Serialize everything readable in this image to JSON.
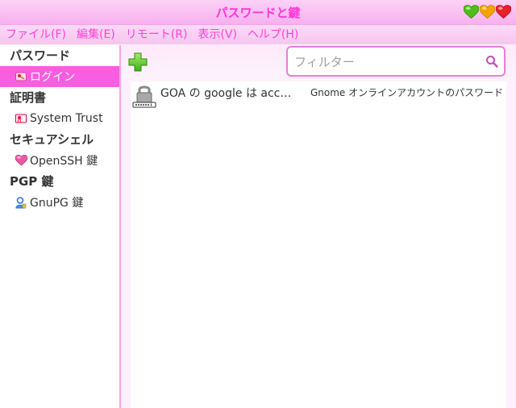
{
  "window": {
    "title": "パスワードと鍵"
  },
  "menubar": {
    "items": [
      "ファイル(F)",
      "編集(E)",
      "リモート(R)",
      "表示(V)",
      "ヘルプ(H)"
    ]
  },
  "sidebar": {
    "categories": [
      {
        "label": "パスワード",
        "items": [
          {
            "label": "ログイン",
            "icon": "keyring-icon",
            "selected": true
          }
        ]
      },
      {
        "label": "証明書",
        "items": [
          {
            "label": "System Trust",
            "icon": "certificate-icon"
          }
        ]
      },
      {
        "label": "セキュアシェル",
        "items": [
          {
            "label": "OpenSSH 鍵",
            "icon": "ssh-key-icon"
          }
        ]
      },
      {
        "label": "PGP 鍵",
        "items": [
          {
            "label": "GnuPG 鍵",
            "icon": "user-key-icon"
          }
        ]
      }
    ]
  },
  "toolbar": {
    "add_icon": "plus-icon",
    "filter_placeholder": "フィルター",
    "search_icon": "search-icon"
  },
  "list": {
    "rows": [
      {
        "name": "GOA の google は acc…",
        "description": "Gnome オンラインアカウントのパスワード",
        "icon": "password-lock-icon"
      }
    ]
  },
  "colors": {
    "accent": "#ff34d6",
    "selection": "#f95de0",
    "sidebar_border": "#f6a4ea"
  }
}
